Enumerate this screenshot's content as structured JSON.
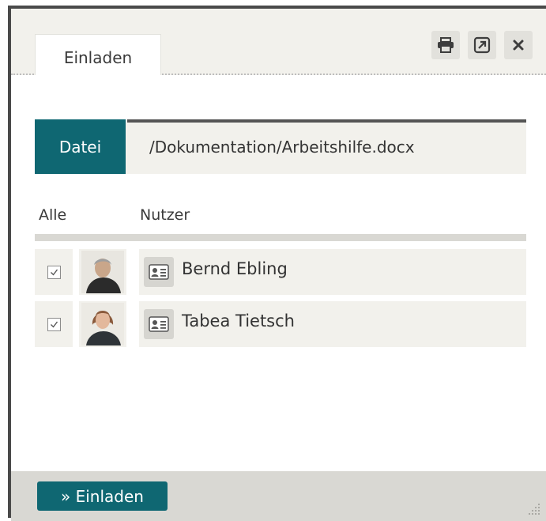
{
  "tab": {
    "label": "Einladen"
  },
  "header_buttons": [
    {
      "name": "print-icon",
      "tooltip": ""
    },
    {
      "name": "external-link-icon",
      "tooltip": ""
    },
    {
      "name": "close-icon",
      "tooltip": ""
    }
  ],
  "file": {
    "label": "Datei",
    "path": "/Dokumentation/Arbeitshilfe.docx"
  },
  "columns": {
    "all": "Alle",
    "user": "Nutzer"
  },
  "users": [
    {
      "name": "Bernd Ebling",
      "checked": true
    },
    {
      "name": "Tabea Tietsch",
      "checked": true
    }
  ],
  "footer": {
    "invite_label": "» Einladen"
  },
  "colors": {
    "accent": "#0f6772",
    "panel": "#f2f1ec",
    "footer": "#d9d8d3",
    "border": "#4a4a4a"
  }
}
